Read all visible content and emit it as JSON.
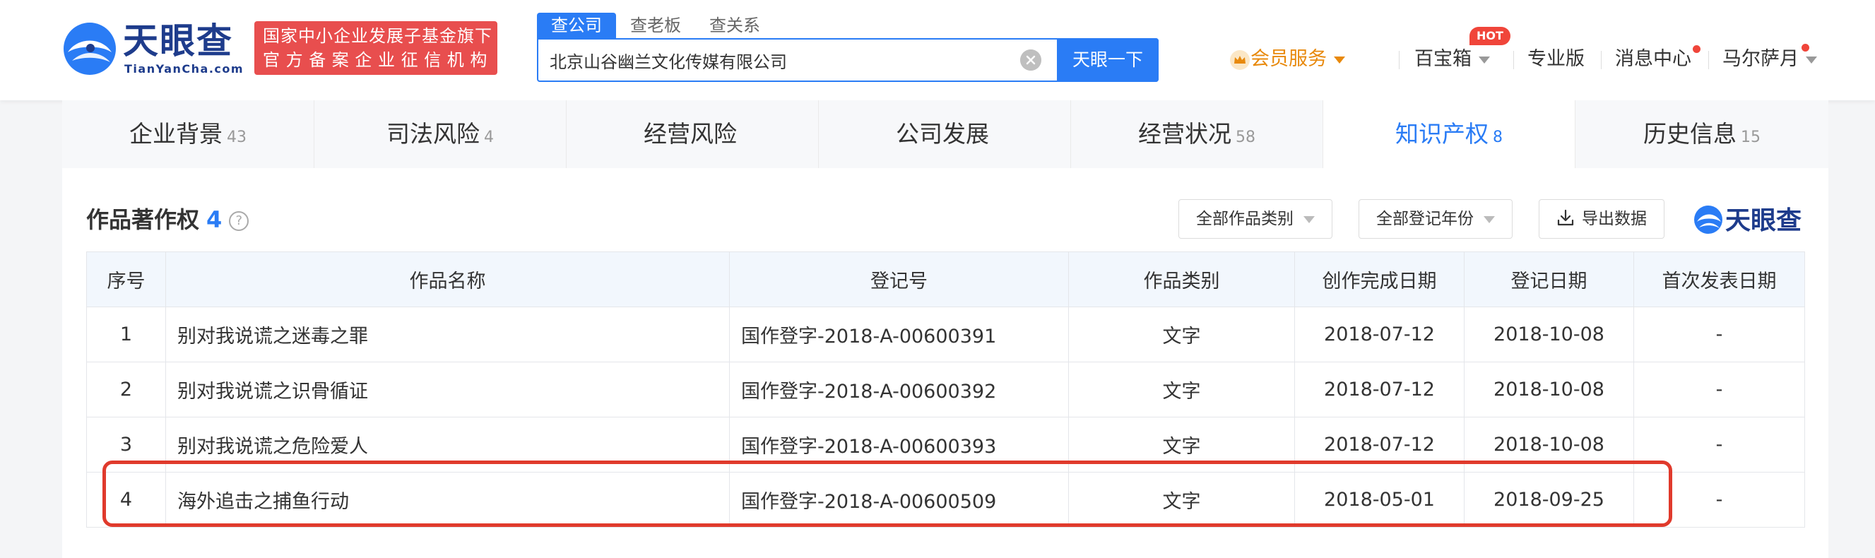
{
  "brand": {
    "name": "天眼查",
    "domain": "TianYanCha.com",
    "slogan_line1": "国家中小企业发展子基金旗下",
    "slogan_line2": "官方备案企业征信机构",
    "logo_color": "#1e3c8c"
  },
  "search": {
    "tabs": [
      "查公司",
      "查老板",
      "查关系"
    ],
    "active_tab": "查公司",
    "value": "北京山谷幽兰文化传媒有限公司",
    "button_label": "天眼一下"
  },
  "nav": {
    "vip_label": "会员服务",
    "toolbox_label": "百宝箱",
    "hot_badge": "HOT",
    "pro_label": "专业版",
    "messages_label": "消息中心",
    "user_label": "马尔萨月"
  },
  "tabs": [
    {
      "label": "企业背景",
      "count": "43"
    },
    {
      "label": "司法风险",
      "count": "4"
    },
    {
      "label": "经营风险",
      "count": ""
    },
    {
      "label": "公司发展",
      "count": ""
    },
    {
      "label": "经营状况",
      "count": "58"
    },
    {
      "label": "知识产权",
      "count": "8"
    },
    {
      "label": "历史信息",
      "count": "15"
    }
  ],
  "active_tab": "知识产权",
  "section": {
    "title": "作品著作权",
    "count": "4",
    "help": "?",
    "filter_category": "全部作品类别",
    "filter_year": "全部登记年份",
    "export_label": "导出数据"
  },
  "table": {
    "headers": [
      "序号",
      "作品名称",
      "登记号",
      "作品类别",
      "创作完成日期",
      "登记日期",
      "首次发表日期"
    ],
    "rows": [
      [
        "1",
        "别对我说谎之迷毒之罪",
        "国作登字-2018-A-00600391",
        "文字",
        "2018-07-12",
        "2018-10-08",
        "-"
      ],
      [
        "2",
        "别对我说谎之识骨循证",
        "国作登字-2018-A-00600392",
        "文字",
        "2018-07-12",
        "2018-10-08",
        "-"
      ],
      [
        "3",
        "别对我说谎之危险爱人",
        "国作登字-2018-A-00600393",
        "文字",
        "2018-07-12",
        "2018-10-08",
        "-"
      ],
      [
        "4",
        "海外追击之捕鱼行动",
        "国作登字-2018-A-00600509",
        "文字",
        "2018-05-01",
        "2018-09-25",
        "-"
      ]
    ]
  },
  "colors": {
    "accent": "#2a7cf5",
    "vip": "#e8890c",
    "slogan_bg": "#e84e4e",
    "highlight": "#e03a2c"
  }
}
